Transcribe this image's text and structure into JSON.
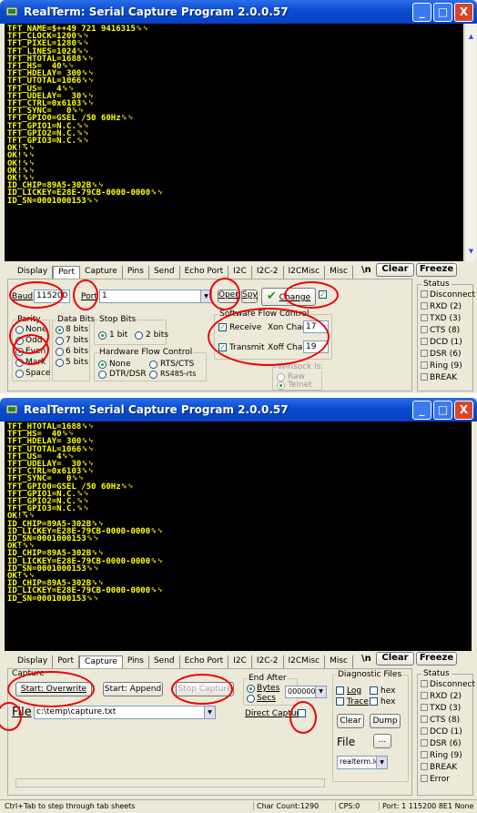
{
  "window": {
    "title": "RealTerm: Serial Capture Program 2.0.0.57",
    "minimize": "_",
    "maximize": "□",
    "close": "X"
  },
  "terminal_top": [
    "TFT_NAME=$++49 721 9416315␍␊",
    "TFT_CLOCK=1200␍␊",
    "TFT_PIXEL=1280␍␊",
    "TFT_LINES=1024␍␊",
    "TFT_HTOTAL=1688␍␊",
    "TFT_HS=  40␍␊",
    "TFT_HDELAY= 300␍␊",
    "TFT_UTOTAL=1066␍␊",
    "TFT_US=   4␍␊",
    "TFT_UDELAY=  30␍␊",
    "TFT_CTRL=0x6103␍␊",
    "TFT_SYNC=   0␍␊",
    "TFT_GPIO0=GSEL /50 60Hz␍␊",
    "TFT_GPIO1=N.C.␍␊",
    "TFT_GPIO2=N.C.␍␊",
    "TFT_GPIO3=N.C.␍␊",
    "OK!␍␊",
    "OK!␍␊",
    "OK!␍␊",
    "OK!␍␊",
    "OK!␍␊",
    "ID_CHIP=89A5-302B␍␊",
    "ID_LICKEY=E28E-79CB-0000-0000␍␊",
    "ID_SN=0001000153␍␊"
  ],
  "terminal_bottom": [
    "TFT_HTOTAL=1688␍␊",
    "TFT_HS=  40␍␊",
    "TFT_HDELAY= 300␍␊",
    "TFT_UTOTAL=1066␍␊",
    "TFT_US=   4␍␊",
    "TFT_UDELAY=  30␍␊",
    "TFT_CTRL=0x6103␍␊",
    "TFT_SYNC=   0␍␊",
    "TFT_GPIO0=GSEL /50 60Hz␍␊",
    "TFT_GPIO1=N.C.␍␊",
    "TFT_GPIO2=N.C.␍␊",
    "TFT_GPIO3=N.C.␍␊",
    "OK!␍␊",
    "ID_CHIP=89A5-302B␍␊",
    "ID_LICKEY=E28E-79CB-0000-0000␍␊",
    "ID_SN=0001000153␍␊",
    "OK!␍␊",
    "ID_CHIP=89A5-302B␍␊",
    "ID_LICKEY=E28E-79CB-0000-0000␍␊",
    "ID_SN=0001000153␍␊",
    "OK!␍␊",
    "ID_CHIP=89A5-302B␍␊",
    "ID_LICKEY=E28E-79CB-0000-0000␍␊",
    "ID_SN=0001000153␍␊"
  ],
  "tabs": [
    "Display",
    "Port",
    "Capture",
    "Pins",
    "Send",
    "Echo Port",
    "I2C",
    "I2C-2",
    "I2CMisc",
    "Misc"
  ],
  "toolbar": {
    "newline": "\\n",
    "clear": "Clear",
    "freeze": "Freeze"
  },
  "port": {
    "baud_label": "Baud",
    "baud_value": "115200",
    "port_label": "Port",
    "port_value": "1",
    "open": "Open",
    "spy": "Spy",
    "change": "Change",
    "parity_title": "Parity",
    "parity": [
      "None",
      "Odd",
      "Even",
      "Mark",
      "Space"
    ],
    "parity_selected": "Even",
    "databits_title": "Data Bits",
    "databits": [
      "8 bits",
      "7 bits",
      "6 bits",
      "5 bits"
    ],
    "stopbits_title": "Stop Bits",
    "stopbits": [
      "1 bit",
      "2 bits"
    ],
    "hwflow_title": "Hardware Flow Control",
    "hwflow": [
      "None",
      "RTS/CTS",
      "DTR/DSR",
      "RS485-rts"
    ],
    "swflow_title": "Software Flow Control",
    "receive": "Receive",
    "transmit": "Transmit",
    "xon_label": "Xon Char:",
    "xon_value": "17",
    "xoff_label": "Xoff Char:",
    "xoff_value": "19",
    "winsock_title": "Winsock is:",
    "winsock": [
      "Raw",
      "Telnet"
    ]
  },
  "status_top": {
    "title": "Status",
    "items": [
      "Disconnect",
      "RXD (2)",
      "TXD (3)",
      "CTS (8)",
      "DCD (1)",
      "DSR (6)",
      "Ring (9)",
      "BREAK"
    ]
  },
  "capture": {
    "title": "Capture",
    "start_overwrite": "Start: Overwrite",
    "start_append": "Start: Append",
    "stop_capture": "Stop Capture",
    "end_after_title": "End After",
    "bytes": "Bytes",
    "secs": "Secs",
    "bytes_value": "0000000",
    "file_label": "File",
    "file_value": "c:\\temp\\capture.txt",
    "direct_capture": "Direct Capture"
  },
  "diagnostic": {
    "title": "Diagnostic Files",
    "log": "Log",
    "trace": "Trace",
    "hex1": "hex",
    "hex2": "hex",
    "clear": "Clear",
    "dump": "Dump",
    "file_label": "File",
    "browse": "...",
    "log_file": "realterm.log"
  },
  "status_bottom": {
    "title": "Status",
    "items": [
      "Disconnect",
      "RXD (2)",
      "TXD (3)",
      "CTS (8)",
      "DCD (1)",
      "DSR (6)",
      "Ring (9)",
      "BREAK",
      "Error"
    ]
  },
  "statusbar": {
    "hint": "Ctrl+Tab to step through tab sheets",
    "chars": "Char Count:1290",
    "cps": "CPS:0",
    "port": "Port: 1 115200 8E1 None"
  },
  "colors": {
    "terminal_bg": "#000000",
    "terminal_fg": "#ffff00",
    "highlight": "#e00000",
    "titlebar": "#0a4bd0"
  }
}
